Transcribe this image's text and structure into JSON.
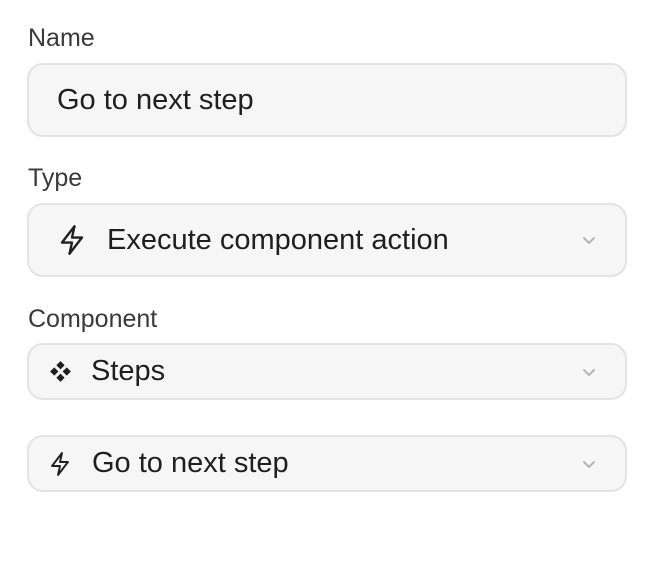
{
  "form": {
    "name_label": "Name",
    "name_value": "Go to next step",
    "type_label": "Type",
    "type_value": "Execute component action",
    "type_icon": "lightning-bolt-icon",
    "component_label": "Component",
    "component_value": "Steps",
    "component_icon": "component-diamond-icon",
    "action_value": "Go to next step",
    "action_icon": "lightning-bolt-icon"
  },
  "colors": {
    "field_bg": "#f6f6f6",
    "field_border": "#e3e3e3",
    "text": "#1f1f1f",
    "label": "#3a3a3a",
    "chevron": "#b5b5b5"
  }
}
